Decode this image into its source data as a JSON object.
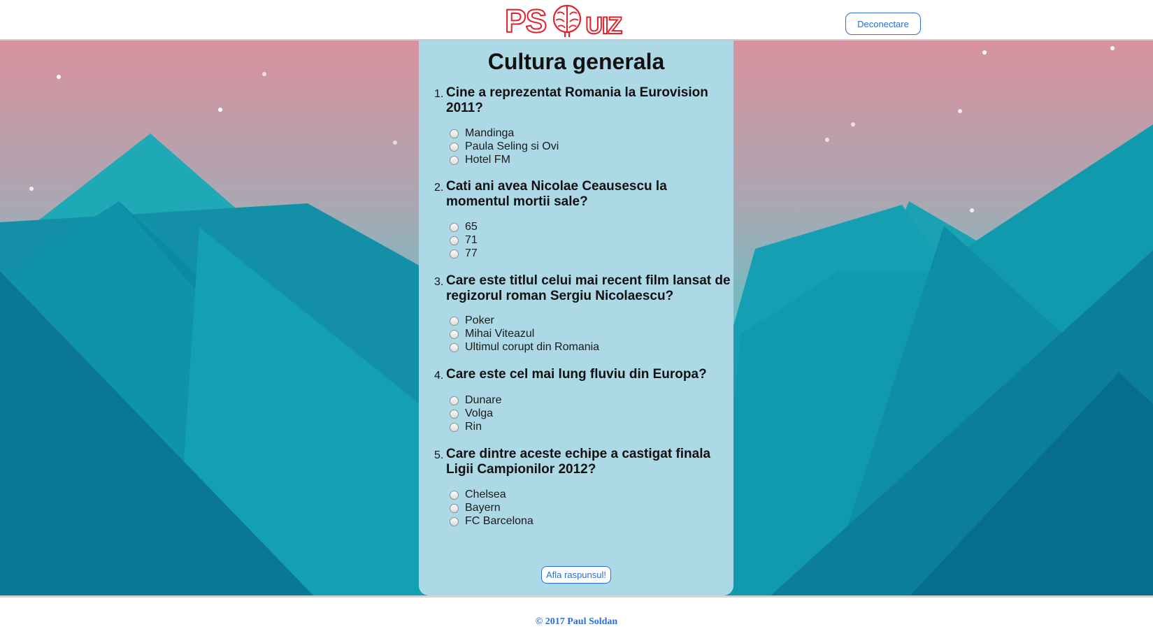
{
  "header": {
    "logo": {
      "left_text": "PS",
      "right_text": "UIZ",
      "icon": "brain-icon",
      "color": "#e0222c"
    },
    "logout_label": "Deconectare"
  },
  "quiz": {
    "title": "Cultura generala",
    "questions": [
      {
        "number": "1.",
        "text": "Cine a reprezentat Romania la Eurovision 2011?",
        "options": [
          "Mandinga",
          "Paula Seling si Ovi",
          "Hotel FM"
        ]
      },
      {
        "number": "2.",
        "text": "Cati ani avea Nicolae Ceausescu la momentul mortii sale?",
        "options": [
          "65",
          "71",
          "77"
        ]
      },
      {
        "number": "3.",
        "text": "Care este titlul celui mai recent film lansat de regizorul roman Sergiu Nicolaescu?",
        "options": [
          "Poker",
          "Mihai Viteazul",
          "Ultimul corupt din Romania"
        ]
      },
      {
        "number": "4.",
        "text": "Care este cel mai lung fluviu din Europa?",
        "options": [
          "Dunare",
          "Volga",
          "Rin"
        ]
      },
      {
        "number": "5.",
        "text": "Care dintre aceste echipe a castigat finala Ligii Campionilor 2012?",
        "options": [
          "Chelsea",
          "Bayern",
          "FC Barcelona"
        ]
      }
    ],
    "submit_label": "Afla raspunsul!"
  },
  "footer": {
    "text": "© 2017 Paul Soldan"
  },
  "colors": {
    "sky_top": "#d9929f",
    "sky_mid": "#a9a8b3",
    "mountain_light": "#1ec3cc",
    "mountain_dark": "#0a7f9a",
    "card_bg": "#add8e6",
    "accent_blue": "#2a6fd1"
  }
}
